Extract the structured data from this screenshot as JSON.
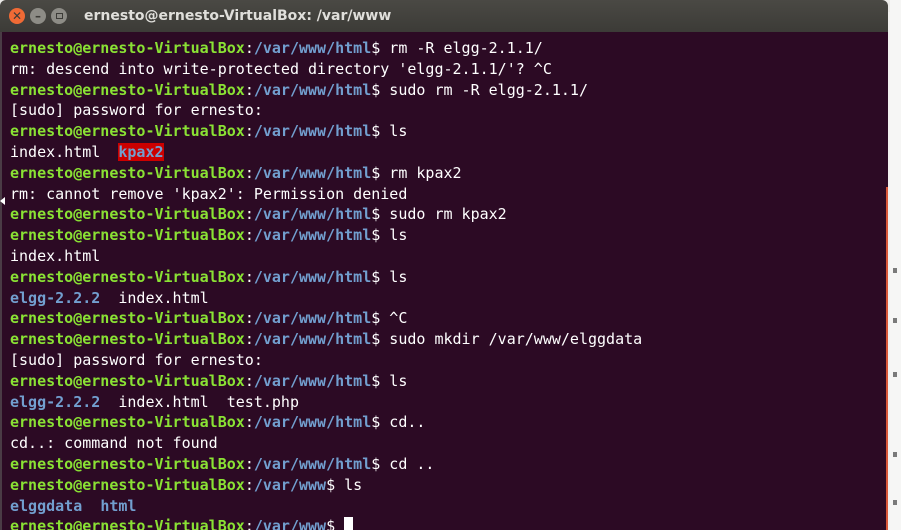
{
  "window": {
    "title": "ernesto@ernesto-VirtualBox: /var/www",
    "close_glyph": "✕",
    "minimize_glyph": "–"
  },
  "colors": {
    "terminal_bg": "#2c0a24",
    "prompt_user": "#8ae234",
    "prompt_path": "#729fcf",
    "text": "#ffffff",
    "highlight_bg": "#cc0000"
  },
  "terminal": {
    "lines": [
      [
        {
          "t": "ernesto@ernesto-VirtualBox",
          "c": "u"
        },
        {
          "t": ":",
          "c": "x"
        },
        {
          "t": "/var/www/html",
          "c": "p"
        },
        {
          "t": "$ rm -R elgg-2.1.1/",
          "c": "x"
        }
      ],
      [
        {
          "t": "rm: descend into write-protected directory 'elgg-2.1.1/'? ^C",
          "c": "x"
        }
      ],
      [
        {
          "t": "ernesto@ernesto-VirtualBox",
          "c": "u"
        },
        {
          "t": ":",
          "c": "x"
        },
        {
          "t": "/var/www/html",
          "c": "p"
        },
        {
          "t": "$ sudo rm -R elgg-2.1.1/",
          "c": "x"
        }
      ],
      [
        {
          "t": "[sudo] password for ernesto:",
          "c": "x"
        }
      ],
      [
        {
          "t": "ernesto@ernesto-VirtualBox",
          "c": "u"
        },
        {
          "t": ":",
          "c": "x"
        },
        {
          "t": "/var/www/html",
          "c": "p"
        },
        {
          "t": "$ ls",
          "c": "x"
        }
      ],
      [
        {
          "t": "index.html  ",
          "c": "x"
        },
        {
          "t": "kpax2",
          "c": "hl"
        }
      ],
      [
        {
          "t": "ernesto@ernesto-VirtualBox",
          "c": "u"
        },
        {
          "t": ":",
          "c": "x"
        },
        {
          "t": "/var/www/html",
          "c": "p"
        },
        {
          "t": "$ rm kpax2",
          "c": "x"
        }
      ],
      [
        {
          "t": "rm: cannot remove 'kpax2': Permission denied",
          "c": "x"
        }
      ],
      [
        {
          "t": "ernesto@ernesto-VirtualBox",
          "c": "u"
        },
        {
          "t": ":",
          "c": "x"
        },
        {
          "t": "/var/www/html",
          "c": "p"
        },
        {
          "t": "$ sudo rm kpax2",
          "c": "x"
        }
      ],
      [
        {
          "t": "ernesto@ernesto-VirtualBox",
          "c": "u"
        },
        {
          "t": ":",
          "c": "x"
        },
        {
          "t": "/var/www/html",
          "c": "p"
        },
        {
          "t": "$ ls",
          "c": "x"
        }
      ],
      [
        {
          "t": "index.html",
          "c": "x"
        }
      ],
      [
        {
          "t": "ernesto@ernesto-VirtualBox",
          "c": "u"
        },
        {
          "t": ":",
          "c": "x"
        },
        {
          "t": "/var/www/html",
          "c": "p"
        },
        {
          "t": "$ ls",
          "c": "x"
        }
      ],
      [
        {
          "t": "elgg-2.2.2",
          "c": "dir"
        },
        {
          "t": "  index.html",
          "c": "x"
        }
      ],
      [
        {
          "t": "ernesto@ernesto-VirtualBox",
          "c": "u"
        },
        {
          "t": ":",
          "c": "x"
        },
        {
          "t": "/var/www/html",
          "c": "p"
        },
        {
          "t": "$ ^C",
          "c": "x"
        }
      ],
      [
        {
          "t": "ernesto@ernesto-VirtualBox",
          "c": "u"
        },
        {
          "t": ":",
          "c": "x"
        },
        {
          "t": "/var/www/html",
          "c": "p"
        },
        {
          "t": "$ sudo mkdir /var/www/elggdata",
          "c": "x"
        }
      ],
      [
        {
          "t": "[sudo] password for ernesto:",
          "c": "x"
        }
      ],
      [
        {
          "t": "ernesto@ernesto-VirtualBox",
          "c": "u"
        },
        {
          "t": ":",
          "c": "x"
        },
        {
          "t": "/var/www/html",
          "c": "p"
        },
        {
          "t": "$ ls",
          "c": "x"
        }
      ],
      [
        {
          "t": "elgg-2.2.2",
          "c": "dir"
        },
        {
          "t": "  index.html  test.php",
          "c": "x"
        }
      ],
      [
        {
          "t": "ernesto@ernesto-VirtualBox",
          "c": "u"
        },
        {
          "t": ":",
          "c": "x"
        },
        {
          "t": "/var/www/html",
          "c": "p"
        },
        {
          "t": "$ cd..",
          "c": "x"
        }
      ],
      [
        {
          "t": "cd..: command not found",
          "c": "x"
        }
      ],
      [
        {
          "t": "ernesto@ernesto-VirtualBox",
          "c": "u"
        },
        {
          "t": ":",
          "c": "x"
        },
        {
          "t": "/var/www/html",
          "c": "p"
        },
        {
          "t": "$ cd ..",
          "c": "x"
        }
      ],
      [
        {
          "t": "ernesto@ernesto-VirtualBox",
          "c": "u"
        },
        {
          "t": ":",
          "c": "x"
        },
        {
          "t": "/var/www",
          "c": "p"
        },
        {
          "t": "$ ls",
          "c": "x"
        }
      ],
      [
        {
          "t": "elggdata",
          "c": "dir"
        },
        {
          "t": "  ",
          "c": "x"
        },
        {
          "t": "html",
          "c": "dir"
        }
      ],
      [
        {
          "t": "ernesto@ernesto-VirtualBox",
          "c": "u"
        },
        {
          "t": ":",
          "c": "x"
        },
        {
          "t": "/var/www",
          "c": "p"
        },
        {
          "t": "$ ",
          "c": "x"
        }
      ]
    ]
  }
}
